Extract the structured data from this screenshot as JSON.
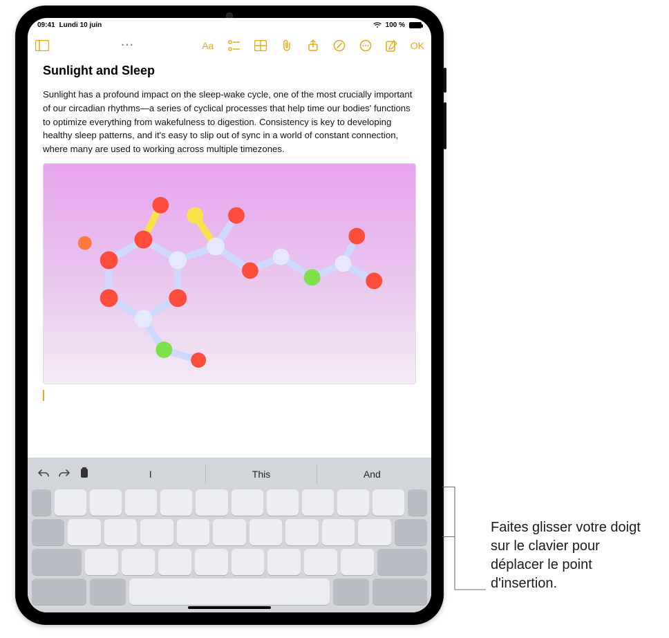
{
  "status": {
    "time": "09:41",
    "date": "Lundi 10 juin",
    "battery": "100 %",
    "full_battery_icon": true
  },
  "toolbar": {
    "sidebar_icon": "sidebar-icon",
    "ellipsis": "···",
    "format_label": "Aa",
    "done_label": "OK"
  },
  "note": {
    "title": "Sunlight and Sleep",
    "body": "Sunlight has a profound impact on the sleep-wake cycle, one of the most crucially important of our circadian rhythms—a series of cyclical processes that help time our bodies' functions to optimize everything from wakefulness to digestion. Consistency is key to developing healthy sleep patterns, and it's easy to slip out of sync in a world of constant connection, where many are used to working across multiple timezones.",
    "image_alt": "melatonin-molecule-illustration"
  },
  "keyboard": {
    "suggestions": [
      "I",
      "This",
      "And"
    ]
  },
  "callout": {
    "text": "Faites glisser votre doigt sur le clavier pour déplacer le point d'insertion."
  }
}
